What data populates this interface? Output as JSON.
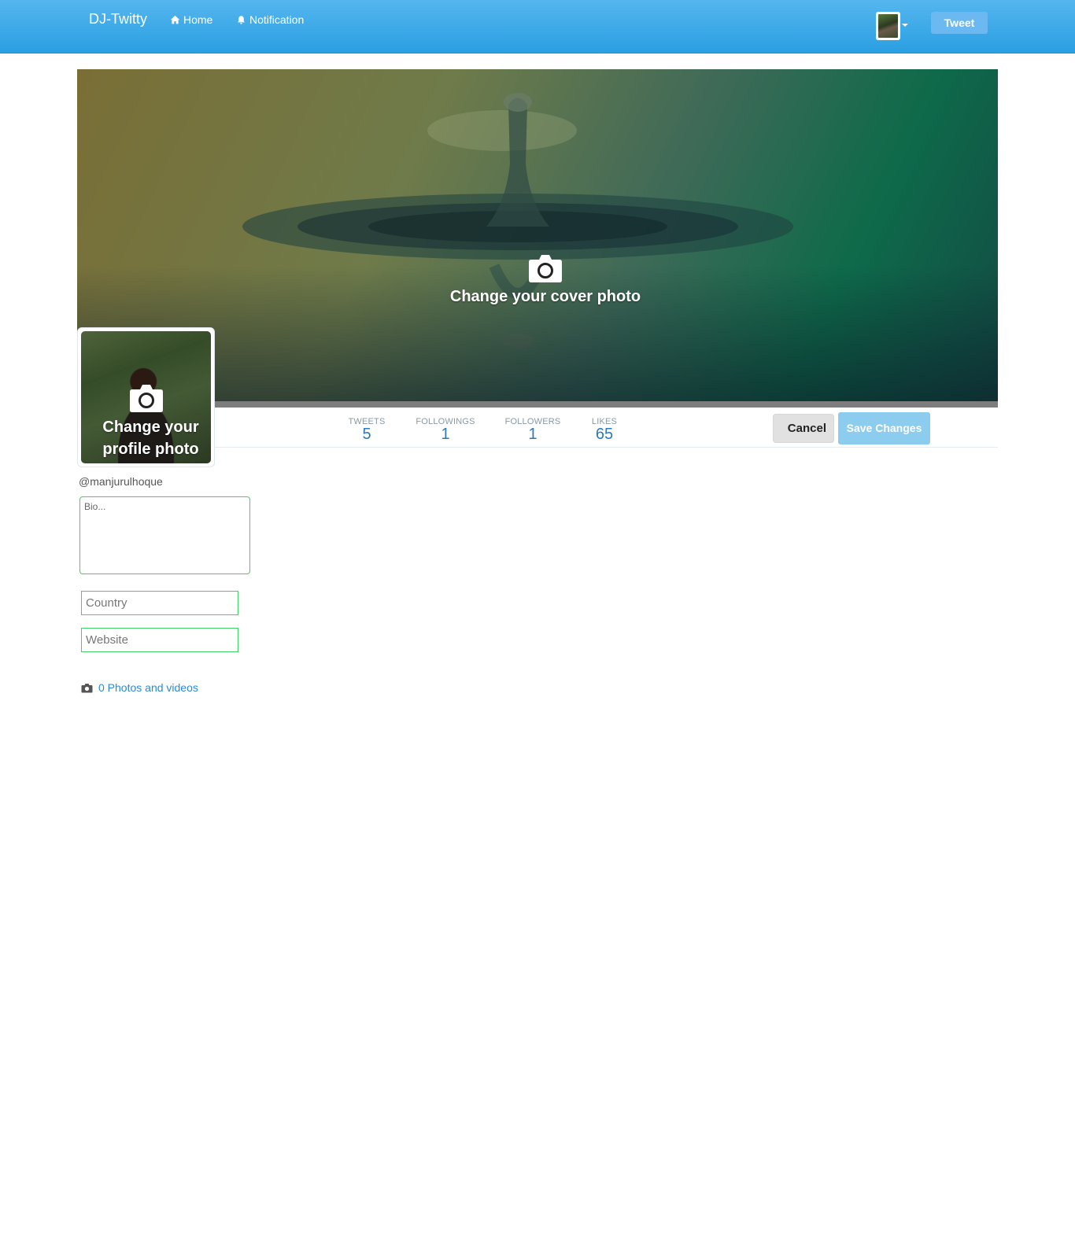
{
  "navbar": {
    "brand": "DJ-Twitty",
    "home_label": "Home",
    "notification_label": "Notification",
    "tweet_button": "Tweet"
  },
  "cover": {
    "cta_label": "Change your cover photo"
  },
  "profile": {
    "cta_label": "Change your profile photo",
    "handle": "@manjurulhoque"
  },
  "stats": [
    {
      "label": "TWEETS",
      "value": "5"
    },
    {
      "label": "FOLLOWINGS",
      "value": "1"
    },
    {
      "label": "FOLLOWERS",
      "value": "1"
    },
    {
      "label": "LIKES",
      "value": "65"
    }
  ],
  "actions": {
    "cancel": "Cancel",
    "save": "Save Changes"
  },
  "form": {
    "bio_placeholder": "Bio...",
    "country_placeholder": "Country",
    "website_placeholder": "Website"
  },
  "media": {
    "photos_label": "0 Photos and videos",
    "icon": "camera-icon"
  },
  "colors": {
    "navbar": "#2a9fe2",
    "accent_blue": "#2a7ab5",
    "save_button": "#8cccef",
    "input_border": "#41d168"
  }
}
